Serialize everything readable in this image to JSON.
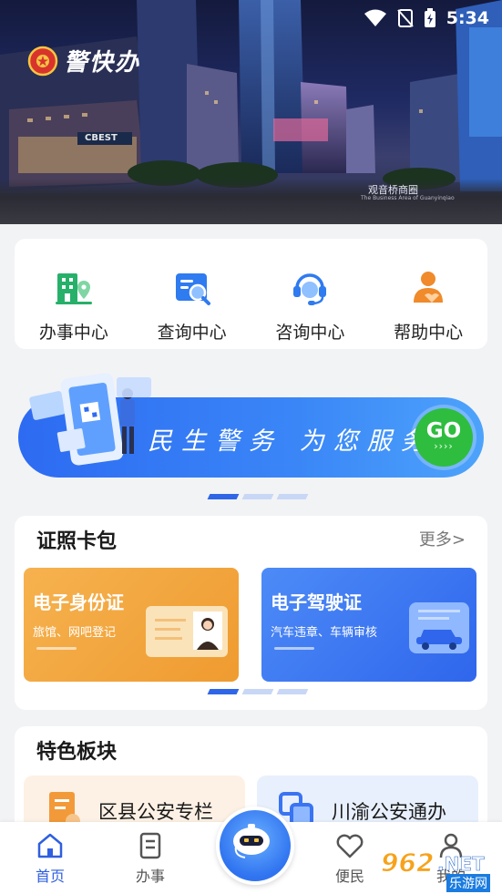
{
  "status_bar": {
    "time": "5:34"
  },
  "hero": {
    "app_name": "警快办",
    "caption": "观音桥商圈",
    "caption_sub": "The Business Area of Guanyinqiao",
    "sign_text": "CBEST"
  },
  "quick_nav": [
    {
      "label": "办事中心",
      "icon": "office-building-icon",
      "color": "#27b06a"
    },
    {
      "label": "查询中心",
      "icon": "search-document-icon",
      "color": "#2f7bf0"
    },
    {
      "label": "咨询中心",
      "icon": "headset-support-icon",
      "color": "#2f7bf0"
    },
    {
      "label": "帮助中心",
      "icon": "helping-person-icon",
      "color": "#f08a2a"
    }
  ],
  "banner": {
    "slogan": "民生警务 为您服务",
    "go_label": "GO",
    "go_arrows": "››››",
    "dots": {
      "count": 3,
      "active": 0
    }
  },
  "wallet": {
    "title": "证照卡包",
    "more": "更多>",
    "cards": [
      {
        "title": "电子身份证",
        "subtitle": "旅馆、网吧登记",
        "color": "#f2a540"
      },
      {
        "title": "电子驾驶证",
        "subtitle": "汽车违章、车辆审核",
        "color": "#3a74f2"
      }
    ],
    "dots": {
      "count": 3,
      "active": 0
    }
  },
  "features": {
    "title": "特色板块",
    "items": [
      {
        "label": "区县公安专栏",
        "bg": "#fdf1e5"
      },
      {
        "label": "川渝公安通办",
        "bg": "#e8f0fd"
      }
    ]
  },
  "tabbar": {
    "tabs": [
      {
        "label": "首页",
        "icon": "home-icon",
        "active": true
      },
      {
        "label": "办事",
        "icon": "document-icon",
        "active": false
      },
      {
        "label": "便民",
        "icon": "heart-icon",
        "active": false
      },
      {
        "label": "我的",
        "icon": "user-icon",
        "active": false
      }
    ]
  },
  "watermark": {
    "brand": "962",
    "net": ".NET",
    "site": "乐游网"
  },
  "colors": {
    "accent": "#2f5fe0",
    "go_green": "#2fbd3f"
  }
}
